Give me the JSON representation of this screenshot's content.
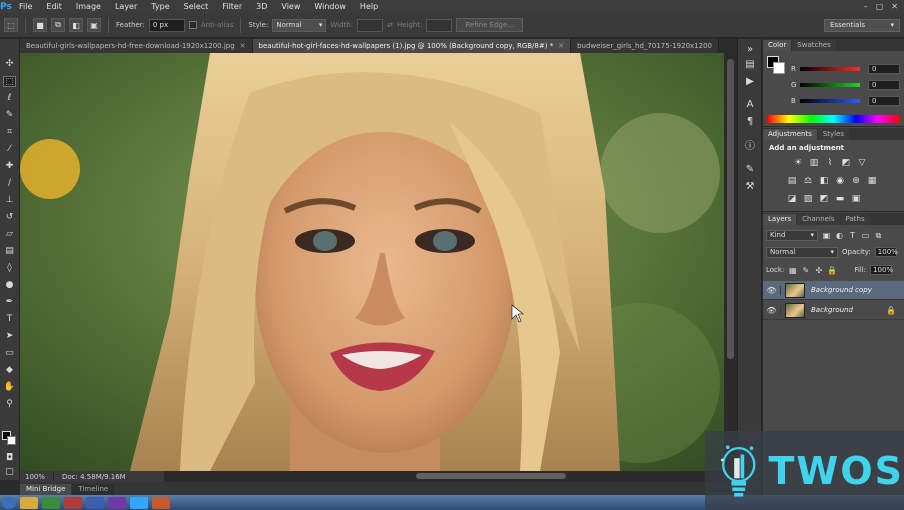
{
  "app": {
    "logo": "Ps"
  },
  "menubar": {
    "items": [
      "File",
      "Edit",
      "Image",
      "Layer",
      "Type",
      "Select",
      "Filter",
      "3D",
      "View",
      "Window",
      "Help"
    ],
    "window_controls": [
      "–",
      "▢",
      "✕"
    ]
  },
  "options": {
    "feather_label": "Feather:",
    "feather_value": "0 px",
    "antialias_label": "Anti-alias",
    "style_label": "Style:",
    "style_value": "Normal",
    "width_label": "Width:",
    "height_label": "Height:",
    "refine_edge": "Refine Edge...",
    "workspace": "Essentials"
  },
  "tabs": [
    {
      "label": "Beautiful-girls-wallpapers-hd-free-download-1920x1200.jpg",
      "active": false
    },
    {
      "label": "beautiful-hot-girl-faces-hd-wallpapers (1).jpg @ 100% (Background copy, RGB/8#) *",
      "active": true
    },
    {
      "label": "budweiser_girls_hd_70175-1920x1200",
      "active": false
    }
  ],
  "status": {
    "zoom": "100%",
    "doc": "Doc: 4.58M/9.16M"
  },
  "minibridge": {
    "tabs": [
      "Mini Bridge",
      "Timeline"
    ]
  },
  "panels": {
    "color": {
      "tabs": [
        "Color",
        "Swatches"
      ],
      "channels": [
        {
          "name": "R",
          "value": "0",
          "gradient": "#ff2a2a"
        },
        {
          "name": "G",
          "value": "0",
          "gradient": "#22d322"
        },
        {
          "name": "B",
          "value": "0",
          "gradient": "#2a5cff"
        }
      ]
    },
    "adjustments": {
      "tabs": [
        "Adjustments",
        "Styles"
      ],
      "title": "Add an adjustment"
    },
    "layers": {
      "tabs": [
        "Layers",
        "Channels",
        "Paths"
      ],
      "kind": "Kind",
      "blend_mode": "Normal",
      "opacity_label": "Opacity:",
      "opacity": "100%",
      "lock_label": "Lock:",
      "fill_label": "Fill:",
      "fill": "100%",
      "items": [
        {
          "name": "Background copy",
          "active": true,
          "locked": false
        },
        {
          "name": "Background",
          "active": false,
          "locked": true
        }
      ]
    }
  },
  "watermark": {
    "brand": "TWOS"
  },
  "colors": {
    "accent": "#31a8ff",
    "logo": "#3fd3ee",
    "selected_layer": "#5a6a7c"
  }
}
